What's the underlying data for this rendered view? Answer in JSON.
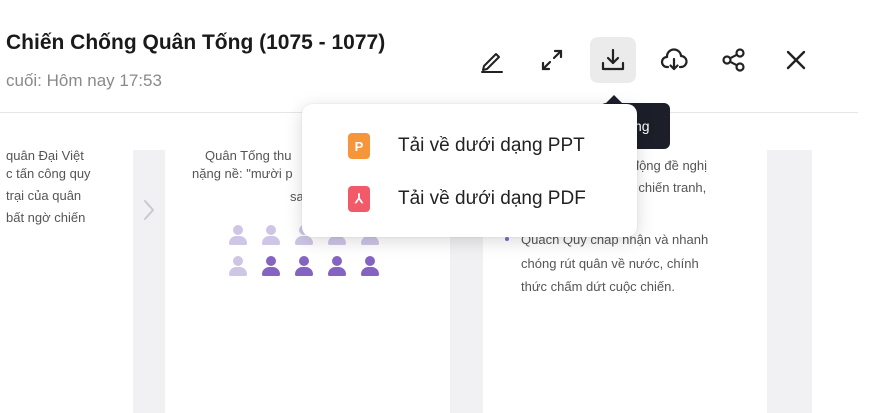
{
  "header": {
    "title": "Chiến Chống Quân Tống (1075 - 1077)",
    "subtitle": "cuối: Hôm nay 17:53"
  },
  "toolbar": {
    "edit_icon": "pencil-icon",
    "expand_icon": "expand-icon",
    "download_icon": "download-icon",
    "cloud_icon": "cloud-download-icon",
    "share_icon": "share-icon",
    "close_icon": "close-icon"
  },
  "tooltip": {
    "text": "ng"
  },
  "download_menu": {
    "items": [
      {
        "label": "Tải về dưới dạng PPT",
        "icon": "ppt-file-icon",
        "icon_text": "P",
        "color": "#f7953b"
      },
      {
        "label": "Tải về dưới dạng PDF",
        "icon": "pdf-file-icon",
        "icon_text": "⅄",
        "color": "#f25a6a"
      }
    ]
  },
  "slides": {
    "left": {
      "lines": [
        "quân Đại Việt",
        "c tấn công quy",
        "trại của quân",
        "bất ngờ chiến"
      ]
    },
    "middle": {
      "lines": [
        "Quân Tống thu",
        "nặng nề: \"mười p",
        "sa"
      ]
    },
    "right": {
      "lines_top": [
        "ủ động đề nghị",
        "úc chiến tranh,",
        "n."
      ],
      "bullet_lines": [
        "Quách Quỳ chấp nhận và nhanh",
        "chóng rút quân về nước, chính",
        "thức chấm dứt cuộc chiến."
      ]
    },
    "people_light_color": "#cfc6e6",
    "people_dark_color": "#8563c0"
  }
}
